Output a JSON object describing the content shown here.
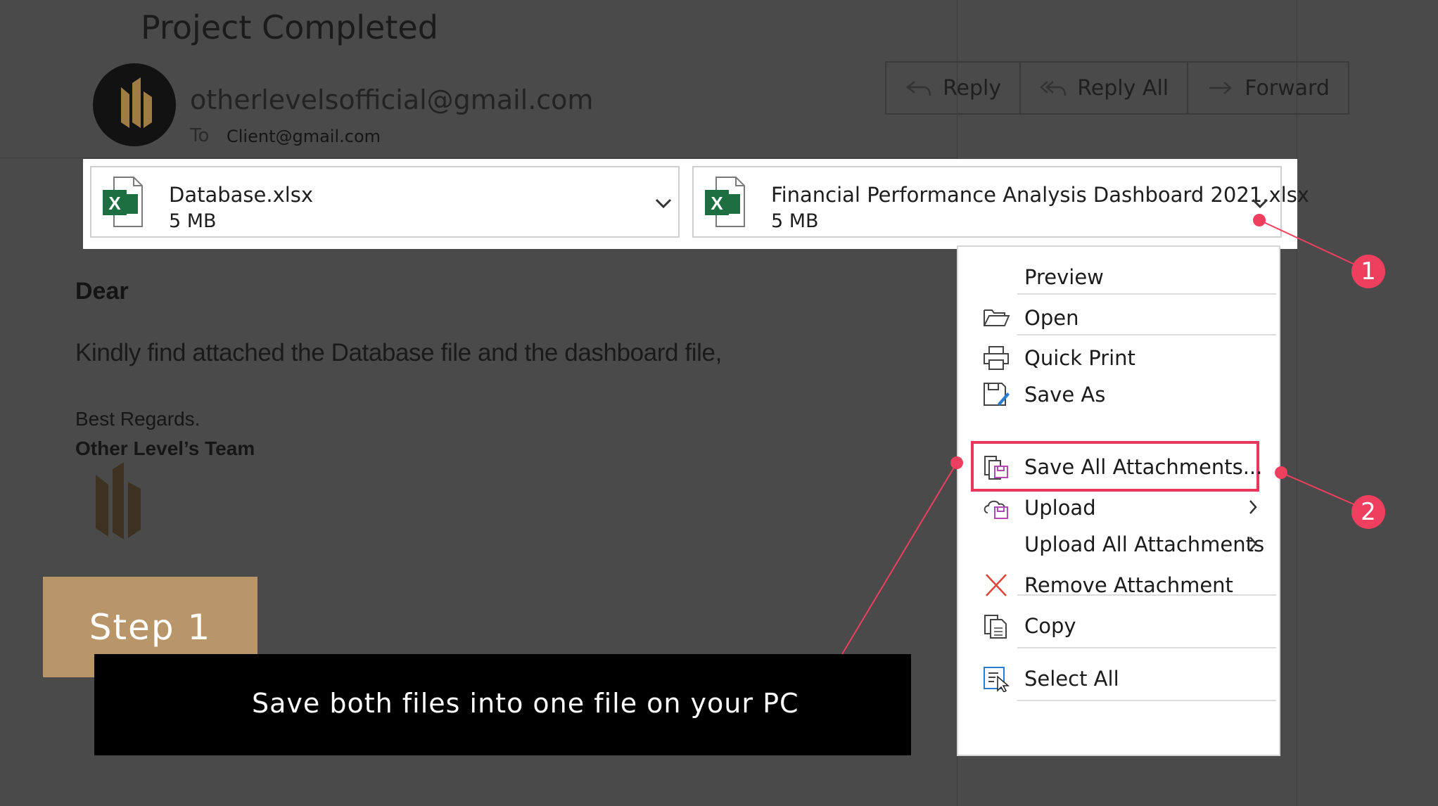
{
  "email": {
    "subject": "Project Completed",
    "sender": "otherlevelsofficial@gmail.com",
    "to_label": "To",
    "to_value": "Client@gmail.com",
    "actions": [
      {
        "label": "Reply",
        "icon": "reply-icon"
      },
      {
        "label": "Reply All",
        "icon": "reply-all-icon"
      },
      {
        "label": "Forward",
        "icon": "forward-icon"
      }
    ]
  },
  "attachments": [
    {
      "name": "Database.xlsx",
      "size": "5 MB",
      "icon": "excel-icon"
    },
    {
      "name": "Financial Performance Analysis Dashboard 2021.xlsx",
      "size": "5 MB",
      "icon": "excel-icon"
    }
  ],
  "body": {
    "greeting": "Dear",
    "text": "Kindly find attached the Database file and the dashboard file,",
    "regards": "Best Regards.",
    "team": "Other Level’s Team"
  },
  "context_menu": {
    "items": [
      {
        "label": "Preview",
        "icon": ""
      },
      {
        "label": "Open",
        "icon": "folder-open-icon"
      },
      {
        "label": "Quick Print",
        "icon": "printer-icon"
      },
      {
        "label": "Save As",
        "icon": "save-as-icon"
      },
      {
        "label": "Save All Attachments...",
        "icon": "save-all-icon",
        "highlighted": true
      },
      {
        "label": "Upload",
        "icon": "upload-cloud-icon",
        "submenu": true
      },
      {
        "label": "Upload All Attachments",
        "icon": "",
        "submenu": true
      },
      {
        "label": "Remove Attachment",
        "icon": "remove-x-icon"
      },
      {
        "label": "Copy",
        "icon": "copy-icon"
      },
      {
        "label": "Select All",
        "icon": "select-all-icon"
      }
    ]
  },
  "tutorial": {
    "step_label": "Step 1",
    "caption": "Save both files into one file on your PC",
    "badges": [
      "1",
      "2"
    ],
    "step_color": "#b9966a",
    "annotation_color": "#ef3f5f"
  }
}
